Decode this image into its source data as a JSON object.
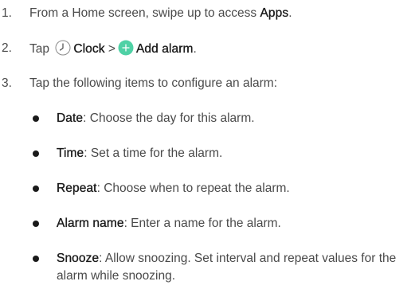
{
  "steps": [
    {
      "num": "1.",
      "pre": "From a Home screen, swipe up to access ",
      "bold": "Apps",
      "post": "."
    },
    {
      "num": "2.",
      "pre": "Tap ",
      "clock_label": "Clock",
      "separator": ">",
      "add_label": "Add alarm",
      "post": "."
    },
    {
      "num": "3.",
      "text": "Tap the following items to configure an alarm:"
    }
  ],
  "bullets": [
    {
      "term": "Date",
      "desc": ": Choose the day for this alarm."
    },
    {
      "term": "Time",
      "desc": ": Set a time for the alarm."
    },
    {
      "term": "Repeat",
      "desc": ": Choose when to repeat the alarm."
    },
    {
      "term": "Alarm name",
      "desc": ": Enter a name for the alarm."
    },
    {
      "term": "Snooze",
      "desc": ": Allow snoozing. Set interval and repeat values for the alarm while snoozing."
    }
  ],
  "icons": {
    "clock": "clock-icon",
    "add": "add-icon"
  },
  "colors": {
    "text": "#4a4a4a",
    "bold": "#1a1a1a",
    "add_icon": "#4fd1a5"
  }
}
